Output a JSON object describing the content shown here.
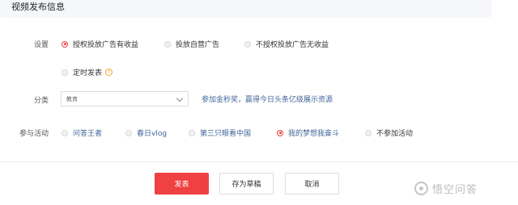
{
  "section": {
    "title": "视频发布信息"
  },
  "settings": {
    "label": "设置",
    "options": [
      {
        "label": "授权投放广告有收益",
        "checked": true
      },
      {
        "label": "投放自营广告",
        "checked": false
      },
      {
        "label": "不授权投放广告无收益",
        "checked": false
      }
    ],
    "scheduled": {
      "label": "定时发表",
      "help_glyph": "?"
    }
  },
  "category": {
    "label": "分类",
    "selected": "教育",
    "promo_link": "参加金秒奖，赢得今日头条亿级展示资源"
  },
  "activity": {
    "label": "参与活动",
    "options": [
      {
        "label": "问答王者",
        "checked": false,
        "link": true
      },
      {
        "label": "春日vlog",
        "checked": false,
        "link": true
      },
      {
        "label": "第三只眼看中国",
        "checked": false,
        "link": true
      },
      {
        "label": "我的梦想我奋斗",
        "checked": true,
        "link": true
      },
      {
        "label": "不参加活动",
        "checked": false,
        "link": false
      }
    ]
  },
  "actions": {
    "publish": "发表",
    "save_draft": "存为草稿",
    "cancel": "取消"
  },
  "watermark": {
    "text": "悟空问答"
  },
  "colors": {
    "accent": "#f04142",
    "link": "#406599"
  }
}
